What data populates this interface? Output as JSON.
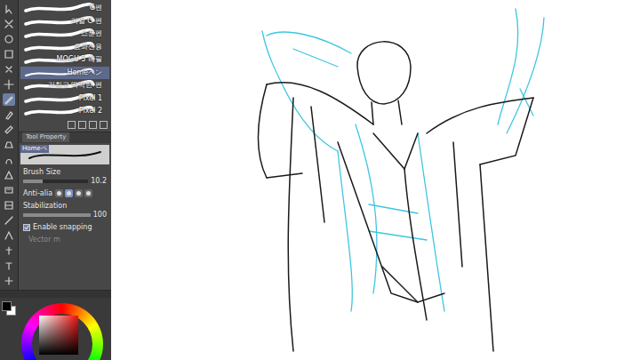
{
  "toolbar": {
    "tools": [
      {
        "selected": false
      },
      {
        "selected": false
      },
      {
        "selected": false
      },
      {
        "selected": false
      },
      {
        "selected": false
      },
      {
        "selected": false
      },
      {
        "selected": true
      },
      {
        "selected": false
      },
      {
        "selected": false
      },
      {
        "selected": false
      },
      {
        "selected": false
      },
      {
        "selected": false
      },
      {
        "selected": false
      },
      {
        "selected": false
      },
      {
        "selected": false
      },
      {
        "selected": false
      },
      {
        "selected": false
      },
      {
        "selected": false
      },
      {
        "selected": false
      }
    ]
  },
  "brush_list": {
    "items": [
      {
        "label": "G펜",
        "selected": false
      },
      {
        "label": "리얼 G 펜",
        "selected": false
      },
      {
        "label": "스푼펜",
        "selected": false
      },
      {
        "label": "효과선용",
        "selected": false
      },
      {
        "label": "MOGU 5 해필",
        "selected": false
      },
      {
        "label": "Homeペン",
        "selected": true
      },
      {
        "label": "거칠고 딱딱한 펜",
        "selected": false
      },
      {
        "label": "Pixel 1",
        "selected": false
      },
      {
        "label": "Pixel 2",
        "selected": false
      }
    ]
  },
  "tool_property": {
    "tab": "Tool Property",
    "brush_name": "Homeペ",
    "fields": [
      {
        "kind": "slider",
        "label": "Brush Size",
        "value": "10.2",
        "level": 0.3
      },
      {
        "kind": "antialias",
        "label": "Anti-alia",
        "options": [
          {
            "selected": false
          },
          {
            "selected": true
          },
          {
            "selected": false
          },
          {
            "selected": false
          }
        ]
      },
      {
        "kind": "slider",
        "label": "Stabilization",
        "value": "100",
        "level": 1
      },
      {
        "kind": "checkbox",
        "label": "Enable snapping",
        "checked": true
      },
      {
        "kind": "disabled",
        "label": "Vector m",
        "disabled": true
      }
    ]
  },
  "color": {
    "swatches": [
      {
        "color": "#000000",
        "selected": true
      },
      {
        "color": "#ffffff",
        "selected": false
      }
    ]
  }
}
